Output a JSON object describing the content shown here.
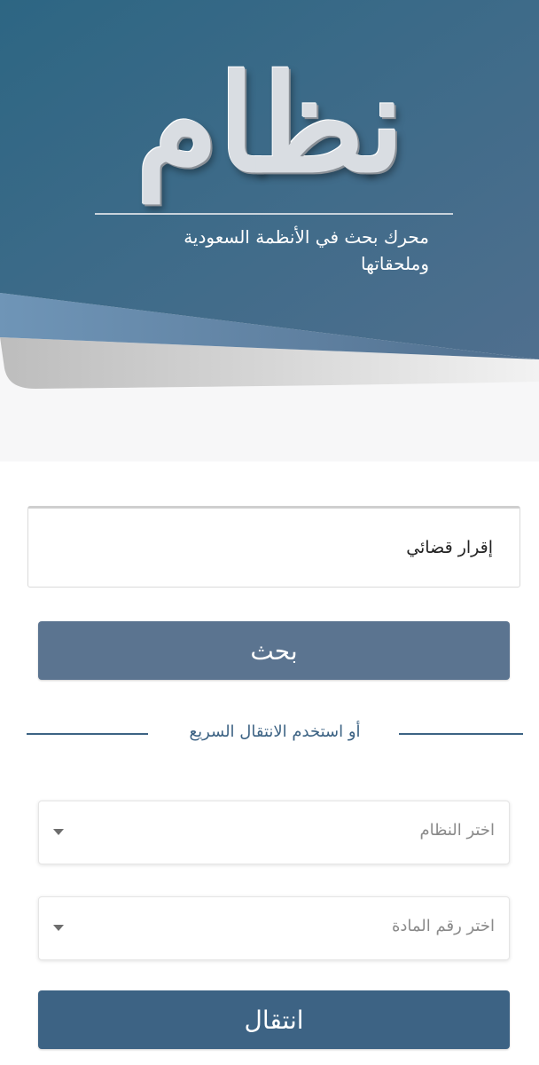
{
  "header": {
    "logo_text": "نظام",
    "tagline_line1": "محرك بحث في الأنظمة السعودية",
    "tagline_line2": "وملحقاتها"
  },
  "search": {
    "value": "إقرار قضائي",
    "button_label": "بحث"
  },
  "quick_nav": {
    "divider_label": "أو استخدم الانتقال السريع",
    "system_select_placeholder": "اختر النظام",
    "article_select_placeholder": "اختر رقم المادة",
    "go_button_label": "انتقال"
  },
  "colors": {
    "header_blue": "#3d6384",
    "search_button": "#5b7490",
    "go_button": "#3d6384"
  }
}
